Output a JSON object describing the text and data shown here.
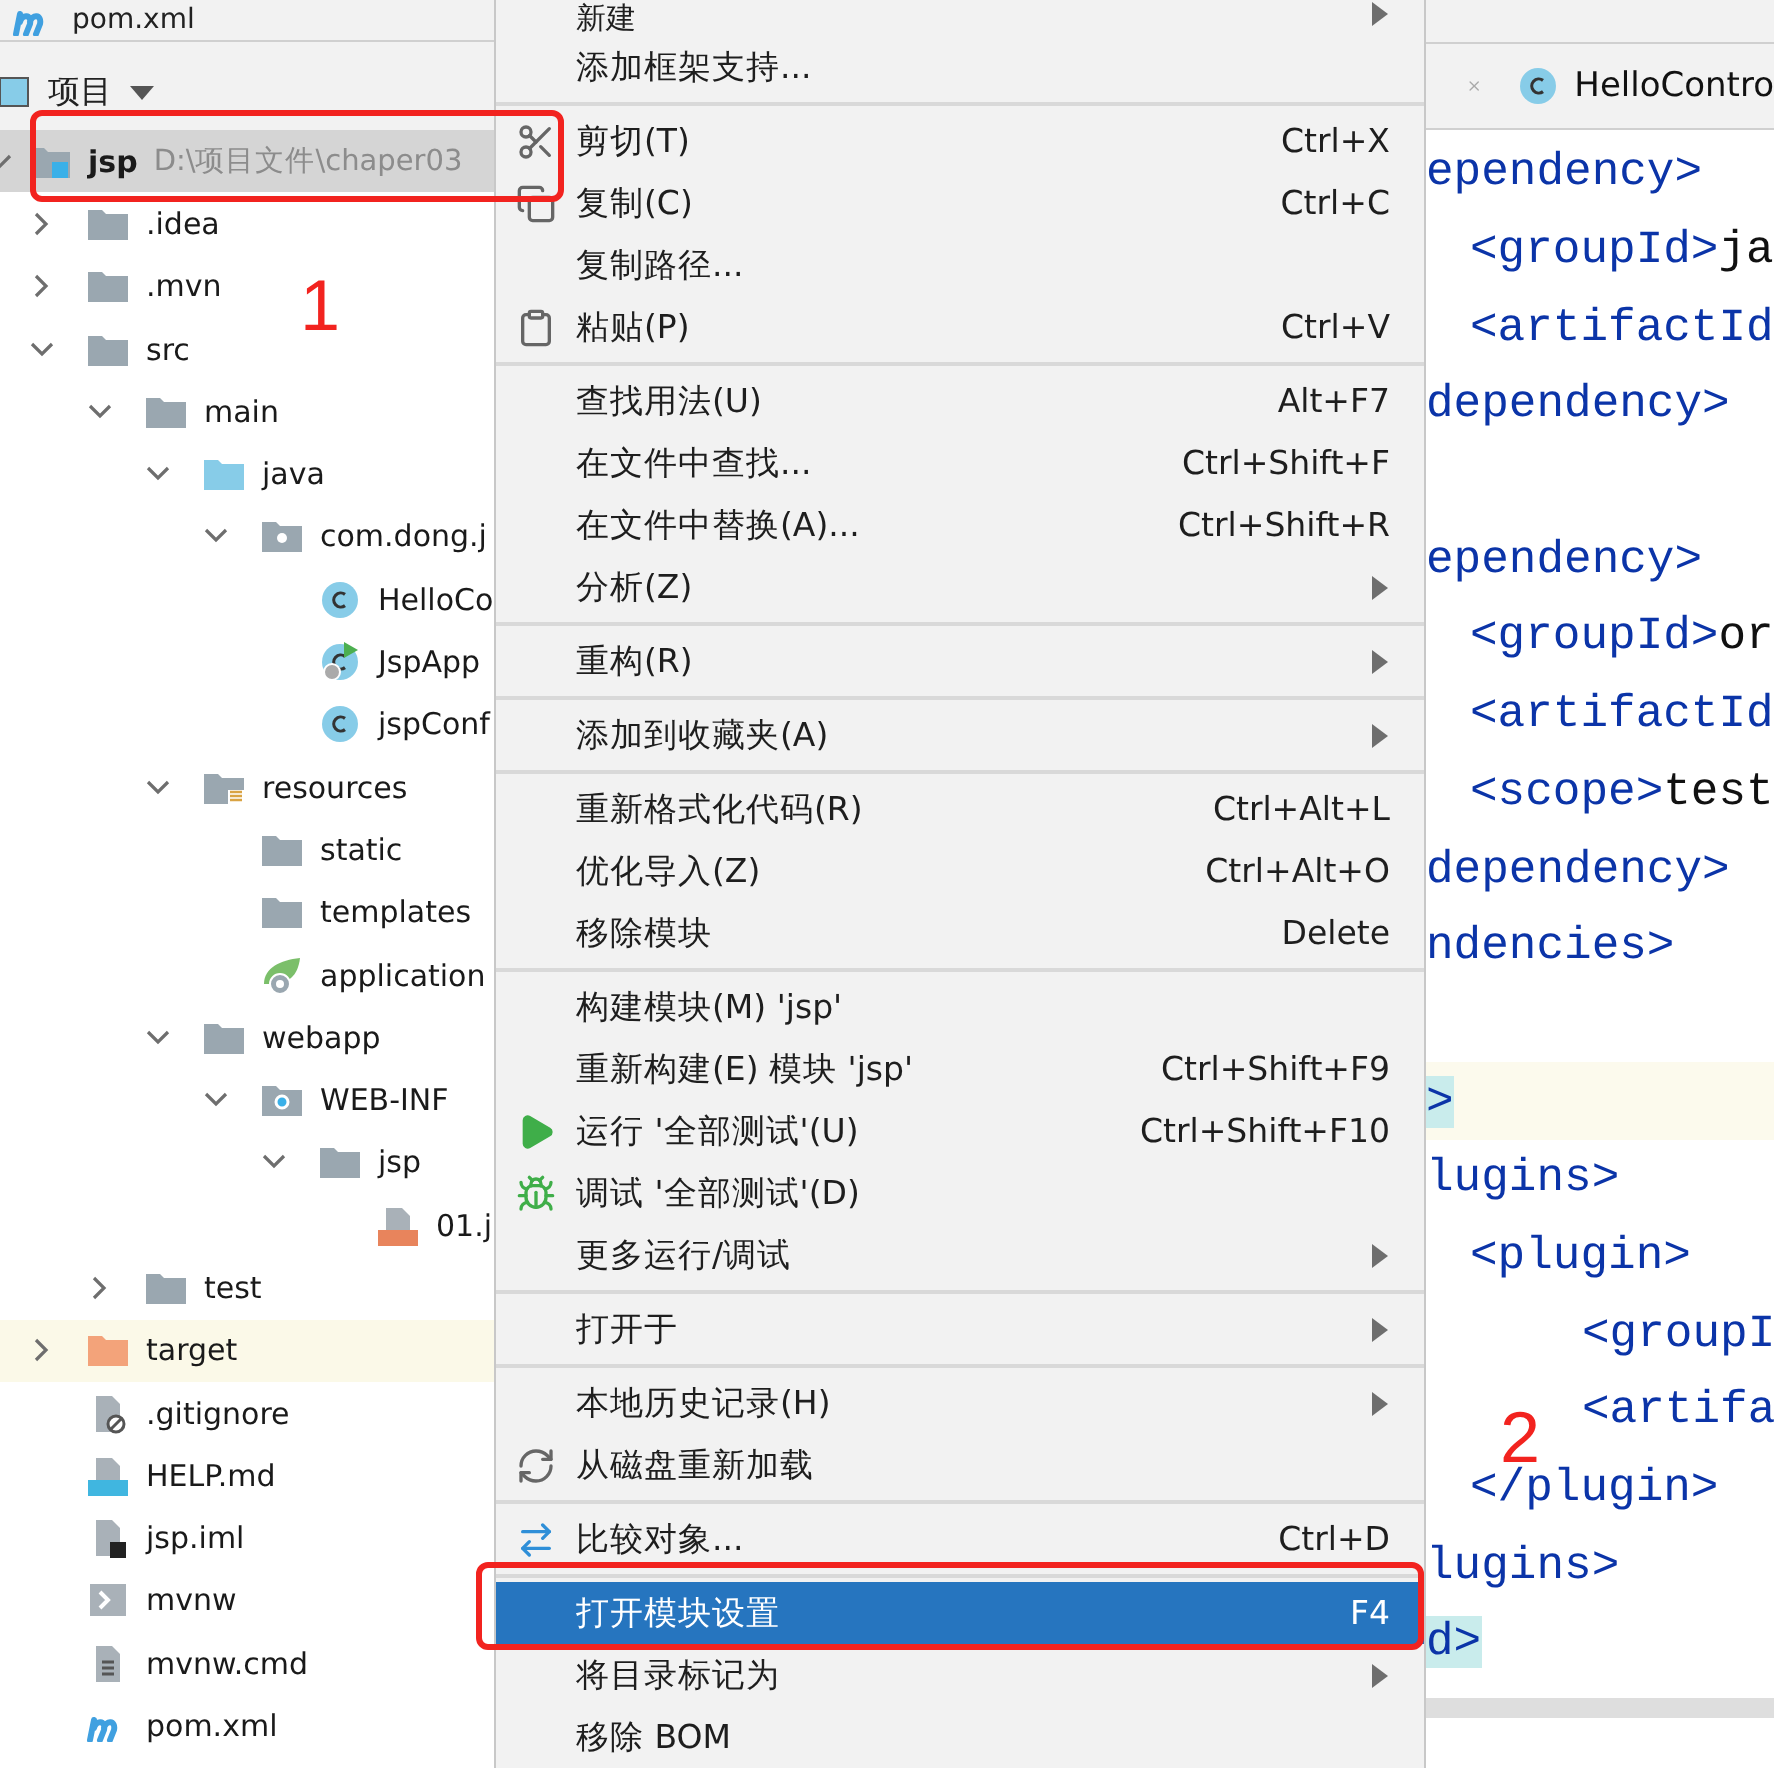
{
  "header": {
    "title": "pom.xml"
  },
  "project_toolbar": {
    "label": "项目"
  },
  "tree": [
    {
      "name": "jsp",
      "hint": "D:\\项目文件\\chaper03",
      "kind": "module",
      "expanded": true,
      "selected": true,
      "children": [
        {
          "name": ".idea",
          "kind": "folder",
          "expanded": false,
          "selected": false
        },
        {
          "name": ".mvn",
          "kind": "folder",
          "expanded": false,
          "selected": false
        },
        {
          "name": "src",
          "kind": "folder",
          "expanded": true,
          "selected": false,
          "children": [
            {
              "name": "main",
              "kind": "folder",
              "expanded": true,
              "selected": false,
              "children": [
                {
                  "name": "java",
                  "kind": "source",
                  "expanded": true,
                  "selected": false,
                  "children": [
                    {
                      "name": "com.dong.j",
                      "kind": "package",
                      "expanded": true,
                      "selected": false,
                      "children": [
                        {
                          "name": "HelloCo",
                          "kind": "class",
                          "selected": false
                        },
                        {
                          "name": "JspApp",
                          "kind": "app",
                          "selected": false
                        },
                        {
                          "name": "jspConf",
                          "kind": "class",
                          "selected": false
                        }
                      ]
                    }
                  ]
                },
                {
                  "name": "resources",
                  "kind": "resources",
                  "expanded": true,
                  "selected": false,
                  "children": [
                    {
                      "name": "static",
                      "kind": "folder",
                      "selected": false
                    },
                    {
                      "name": "templates",
                      "kind": "folder",
                      "selected": false
                    },
                    {
                      "name": "application",
                      "kind": "config",
                      "selected": false
                    }
                  ]
                },
                {
                  "name": "webapp",
                  "kind": "folder",
                  "expanded": true,
                  "selected": false,
                  "children": [
                    {
                      "name": "WEB-INF",
                      "kind": "web",
                      "expanded": true,
                      "selected": false,
                      "children": [
                        {
                          "name": "jsp",
                          "kind": "folder",
                          "expanded": true,
                          "selected": false,
                          "children": [
                            {
                              "name": "01.j",
                              "kind": "jsp",
                              "selected": false
                            }
                          ]
                        }
                      ]
                    }
                  ]
                }
              ]
            },
            {
              "name": "test",
              "kind": "folder",
              "expanded": false,
              "selected": false
            }
          ]
        },
        {
          "name": "target",
          "kind": "excluded",
          "expanded": false,
          "selected": false
        },
        {
          "name": ".gitignore",
          "kind": "ignore",
          "selected": false
        },
        {
          "name": "HELP.md",
          "kind": "markdown",
          "selected": false
        },
        {
          "name": "jsp.iml",
          "kind": "iml",
          "selected": false
        },
        {
          "name": "mvnw",
          "kind": "script",
          "selected": false
        },
        {
          "name": "mvnw.cmd",
          "kind": "text",
          "selected": false
        },
        {
          "name": "pom.xml",
          "kind": "maven",
          "selected": false
        }
      ]
    }
  ],
  "context_menu": {
    "groups": [
      [
        {
          "label": "新建",
          "kind": "plain",
          "submenu": true,
          "selected": false
        },
        {
          "label": "添加框架支持...",
          "kind": "plain",
          "submenu": false,
          "selected": false
        }
      ],
      [
        {
          "label": "剪切(T)",
          "shortcut": "Ctrl+X",
          "kind": "cut",
          "submenu": false,
          "selected": false
        },
        {
          "label": "复制(C)",
          "shortcut": "Ctrl+C",
          "kind": "copy",
          "submenu": false,
          "selected": false
        },
        {
          "label": "复制路径...",
          "kind": "plain",
          "submenu": false,
          "selected": false
        },
        {
          "label": "粘贴(P)",
          "shortcut": "Ctrl+V",
          "kind": "paste",
          "submenu": false,
          "selected": false
        }
      ],
      [
        {
          "label": "查找用法(U)",
          "shortcut": "Alt+F7",
          "kind": "plain",
          "submenu": false,
          "selected": false
        },
        {
          "label": "在文件中查找...",
          "shortcut": "Ctrl+Shift+F",
          "kind": "plain",
          "submenu": false,
          "selected": false
        },
        {
          "label": "在文件中替换(A)...",
          "shortcut": "Ctrl+Shift+R",
          "kind": "plain",
          "submenu": false,
          "selected": false
        },
        {
          "label": "分析(Z)",
          "kind": "plain",
          "submenu": true,
          "selected": false
        }
      ],
      [
        {
          "label": "重构(R)",
          "kind": "plain",
          "submenu": true,
          "selected": false
        }
      ],
      [
        {
          "label": "添加到收藏夹(A)",
          "kind": "plain",
          "submenu": true,
          "selected": false
        }
      ],
      [
        {
          "label": "重新格式化代码(R)",
          "shortcut": "Ctrl+Alt+L",
          "kind": "plain",
          "submenu": false,
          "selected": false
        },
        {
          "label": "优化导入(Z)",
          "shortcut": "Ctrl+Alt+O",
          "kind": "plain",
          "submenu": false,
          "selected": false
        },
        {
          "label": "移除模块",
          "shortcut": "Delete",
          "kind": "plain",
          "submenu": false,
          "selected": false
        }
      ],
      [
        {
          "label": "构建模块(M) 'jsp'",
          "kind": "plain",
          "submenu": false,
          "selected": false
        },
        {
          "label": "重新构建(E) 模块 'jsp'",
          "shortcut": "Ctrl+Shift+F9",
          "kind": "plain",
          "submenu": false,
          "selected": false
        },
        {
          "label": "运行 '全部测试'(U)",
          "shortcut": "Ctrl+Shift+F10",
          "kind": "run",
          "submenu": false,
          "selected": false
        },
        {
          "label": "调试 '全部测试'(D)",
          "kind": "debug",
          "submenu": false,
          "selected": false
        },
        {
          "label": "更多运行/调试",
          "kind": "plain",
          "submenu": true,
          "selected": false
        }
      ],
      [
        {
          "label": "打开于",
          "kind": "plain",
          "submenu": true,
          "selected": false
        }
      ],
      [
        {
          "label": "本地历史记录(H)",
          "kind": "plain",
          "submenu": true,
          "selected": false
        },
        {
          "label": "从磁盘重新加载",
          "kind": "reload",
          "submenu": false,
          "selected": false
        }
      ],
      [
        {
          "label": "比较对象...",
          "shortcut": "Ctrl+D",
          "kind": "compare",
          "submenu": false,
          "selected": false
        }
      ],
      [
        {
          "label": "打开模块设置",
          "shortcut": "F4",
          "kind": "plain",
          "submenu": false,
          "selected": true
        },
        {
          "label": "将目录标记为",
          "kind": "plain",
          "submenu": true,
          "selected": false
        },
        {
          "label": "移除 BOM",
          "kind": "plain",
          "submenu": false,
          "selected": false
        }
      ]
    ]
  },
  "editor": {
    "tabs": [
      {
        "kind": "closed"
      },
      {
        "kind": "class",
        "label": "HelloContro"
      }
    ],
    "lines": [
      {
        "kind": "outer",
        "tag": "ependency>",
        "current": false
      },
      {
        "kind": "inner",
        "tag": "<groupId>",
        "value": "ja",
        "current": false
      },
      {
        "kind": "inner",
        "tag": "<artifactId",
        "current": false
      },
      {
        "kind": "outer",
        "tag": "dependency>",
        "current": false
      },
      {
        "kind": "blank",
        "current": false
      },
      {
        "kind": "outer",
        "tag": "ependency>",
        "current": false
      },
      {
        "kind": "inner",
        "tag": "<groupId>",
        "value": "or",
        "current": false
      },
      {
        "kind": "inner",
        "tag": "<artifactId",
        "current": false
      },
      {
        "kind": "inner",
        "tag": "<scope>",
        "value": "test",
        "current": false
      },
      {
        "kind": "outer",
        "tag": "dependency>",
        "current": false
      },
      {
        "kind": "outer",
        "tag": "ndencies>",
        "current": false
      },
      {
        "kind": "blank",
        "current": false
      },
      {
        "kind": "outer",
        "tag": ">",
        "current": true,
        "matched": true
      },
      {
        "kind": "outer",
        "tag": "lugins>",
        "current": false
      },
      {
        "kind": "inner",
        "tag": "<plugin>",
        "current": false
      },
      {
        "kind": "nested",
        "tag": "<groupI",
        "current": false
      },
      {
        "kind": "nested",
        "tag": "<artifa",
        "current": false
      },
      {
        "kind": "inner",
        "tag": "</plugin>",
        "current": false
      },
      {
        "kind": "outer",
        "tag": "lugins>",
        "current": false
      },
      {
        "kind": "outer",
        "tag": "d>",
        "current": false,
        "matched": true
      }
    ]
  },
  "annotations": [
    {
      "kind": "box"
    },
    {
      "kind": "box"
    },
    {
      "kind": "number",
      "text": "1"
    },
    {
      "kind": "number",
      "text": "2"
    }
  ]
}
